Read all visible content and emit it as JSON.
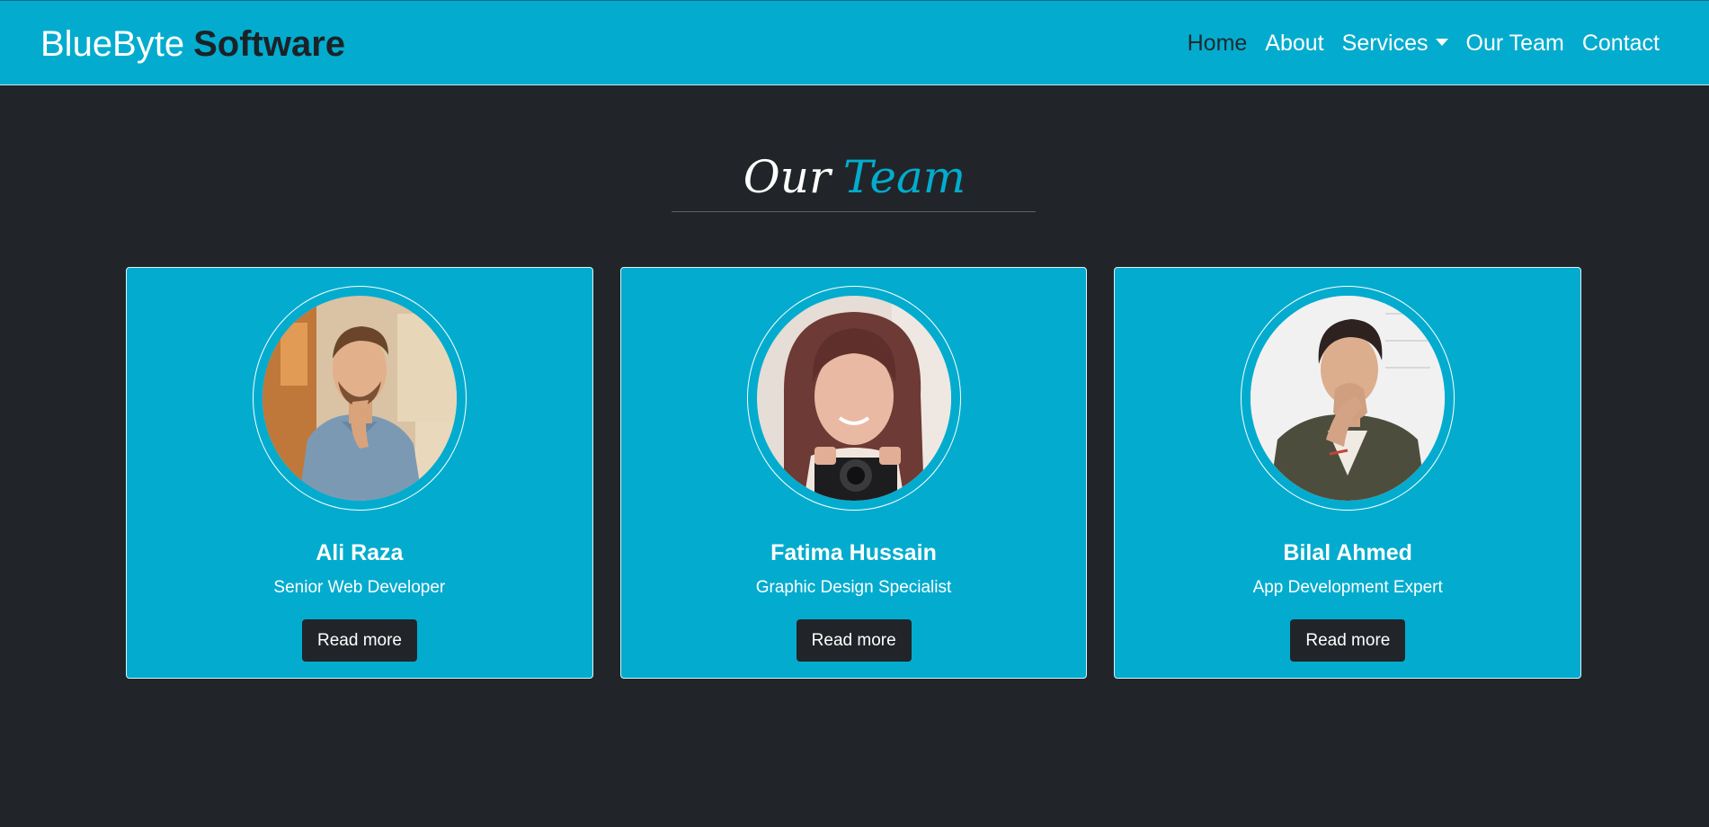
{
  "brand": {
    "light": "BlueByte",
    "bold": "Software"
  },
  "nav": {
    "items": [
      {
        "label": "Home"
      },
      {
        "label": "About"
      },
      {
        "label": "Services"
      },
      {
        "label": "Our Team"
      },
      {
        "label": "Contact"
      }
    ],
    "active": "Home"
  },
  "section": {
    "title_part1": "Our",
    "title_part2": "Team"
  },
  "team": [
    {
      "name": "Ali Raza",
      "role": "Senior Web Developer",
      "button": "Read more"
    },
    {
      "name": "Fatima Hussain",
      "role": "Graphic Design Specialist",
      "button": "Read more"
    },
    {
      "name": "Bilal Ahmed",
      "role": "App Development Expert",
      "button": "Read more"
    }
  ],
  "colors": {
    "accent": "#03acce",
    "background": "#212529",
    "card": "#03acce",
    "button": "#212529"
  }
}
